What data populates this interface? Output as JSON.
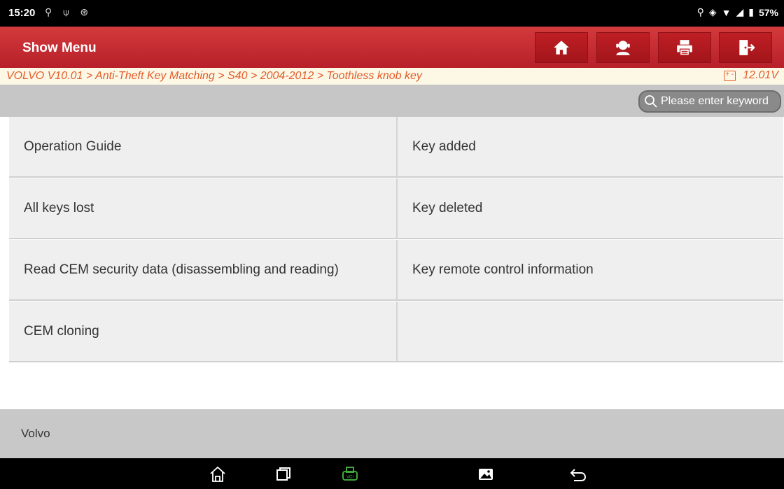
{
  "status_bar": {
    "time": "15:20",
    "battery": "57%"
  },
  "header": {
    "title": "Show Menu",
    "buttons": [
      "home-icon",
      "user-support-icon",
      "print-icon",
      "exit-icon"
    ]
  },
  "breadcrumb": {
    "path": "VOLVO V10.01 > Anti-Theft Key Matching > S40 > 2004-2012 > Toothless knob key",
    "voltage": "12.01V"
  },
  "search": {
    "placeholder": "Please enter keyword"
  },
  "menu": {
    "items": [
      "Operation Guide",
      "Key added",
      "All keys lost",
      "Key deleted",
      "Read CEM security data (disassembling and reading)",
      "Key remote control information",
      "CEM cloning",
      ""
    ]
  },
  "footer": {
    "label": "Volvo"
  },
  "nav_bar": {
    "buttons": [
      "home-icon",
      "recents-icon",
      "vci-icon",
      "screenshot-icon",
      "back-icon"
    ]
  },
  "colors": {
    "title_bar": "#c62a30",
    "breadcrumb_text": "#e35b2a",
    "vci_green": "#3ea83a"
  }
}
